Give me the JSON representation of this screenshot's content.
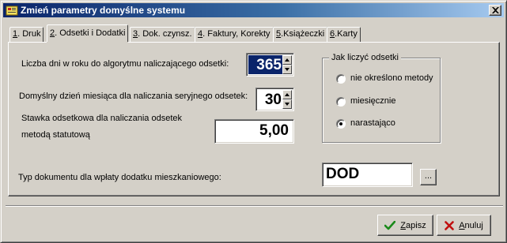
{
  "window": {
    "title": "Zmień parametry domyślne systemu",
    "colors": {
      "titlebar_start": "#0a246a",
      "titlebar_end": "#a6caf0",
      "face": "#d4d0c8"
    }
  },
  "tabs": [
    {
      "mnemonic": "1",
      "rest": ". Druk",
      "active": false
    },
    {
      "mnemonic": "2",
      "rest": ". Odsetki i Dodatki",
      "active": true
    },
    {
      "mnemonic": "3",
      "rest": ". Dok. czynsz.",
      "active": false
    },
    {
      "mnemonic": "4",
      "rest": ". Faktury, Korekty",
      "active": false
    },
    {
      "mnemonic": "5",
      "rest": ".Książeczki",
      "active": false
    },
    {
      "mnemonic": "6",
      "rest": ".Karty",
      "active": false
    }
  ],
  "form": {
    "days_label": "Liczba dni w roku do algorytmu naliczającego odsetki:",
    "days_value": "365",
    "default_day_label": "Domyślny dzień miesiąca dla naliczania seryjnego odsetek:",
    "default_day_value": "30",
    "rate_label_line1": "Stawka odsetkowa dla naliczania odsetek",
    "rate_label_line2": "metodą statutową",
    "rate_value": "5,00",
    "doc_type_label": "Typ dokumentu dla wpłaty dodatku mieszkaniowego:",
    "doc_type_value": "DOD",
    "browse_label": "..."
  },
  "interest_method": {
    "legend": "Jak liczyć odsetki",
    "options": [
      {
        "label": "nie określono metody",
        "selected": false
      },
      {
        "label": "miesięcznie",
        "selected": false
      },
      {
        "label": "narastająco",
        "selected": true
      }
    ]
  },
  "buttons": {
    "save_mnemonic": "Z",
    "save_rest": "apisz",
    "save_icon": "checkmark-icon",
    "cancel_mnemonic": "A",
    "cancel_rest": "nuluj",
    "cancel_icon": "cross-icon"
  }
}
